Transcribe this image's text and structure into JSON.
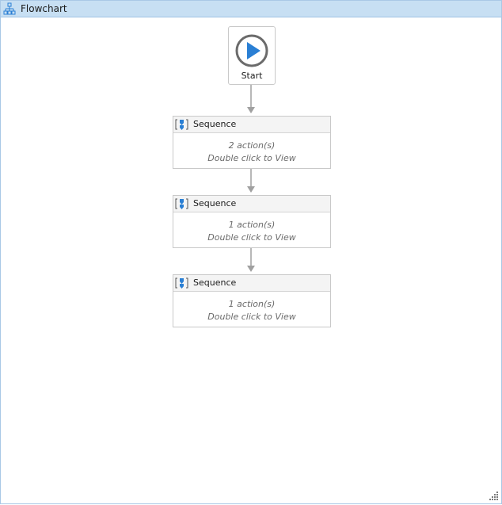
{
  "window": {
    "title": "Flowchart",
    "title_icon": "flowchart-icon"
  },
  "start": {
    "label": "Start",
    "icon": "play-circle-icon"
  },
  "sequences": [
    {
      "title": "Sequence",
      "count": "2 action(s)",
      "hint": "Double click to View",
      "icon": "sequence-icon"
    },
    {
      "title": "Sequence",
      "count": "1 action(s)",
      "hint": "Double click to View",
      "icon": "sequence-icon"
    },
    {
      "title": "Sequence",
      "count": "1 action(s)",
      "hint": "Double click to View",
      "icon": "sequence-icon"
    }
  ],
  "colors": {
    "accent": "#2a7fd4",
    "titlebar": "#c7dff3",
    "connector": "#a0a0a0"
  }
}
